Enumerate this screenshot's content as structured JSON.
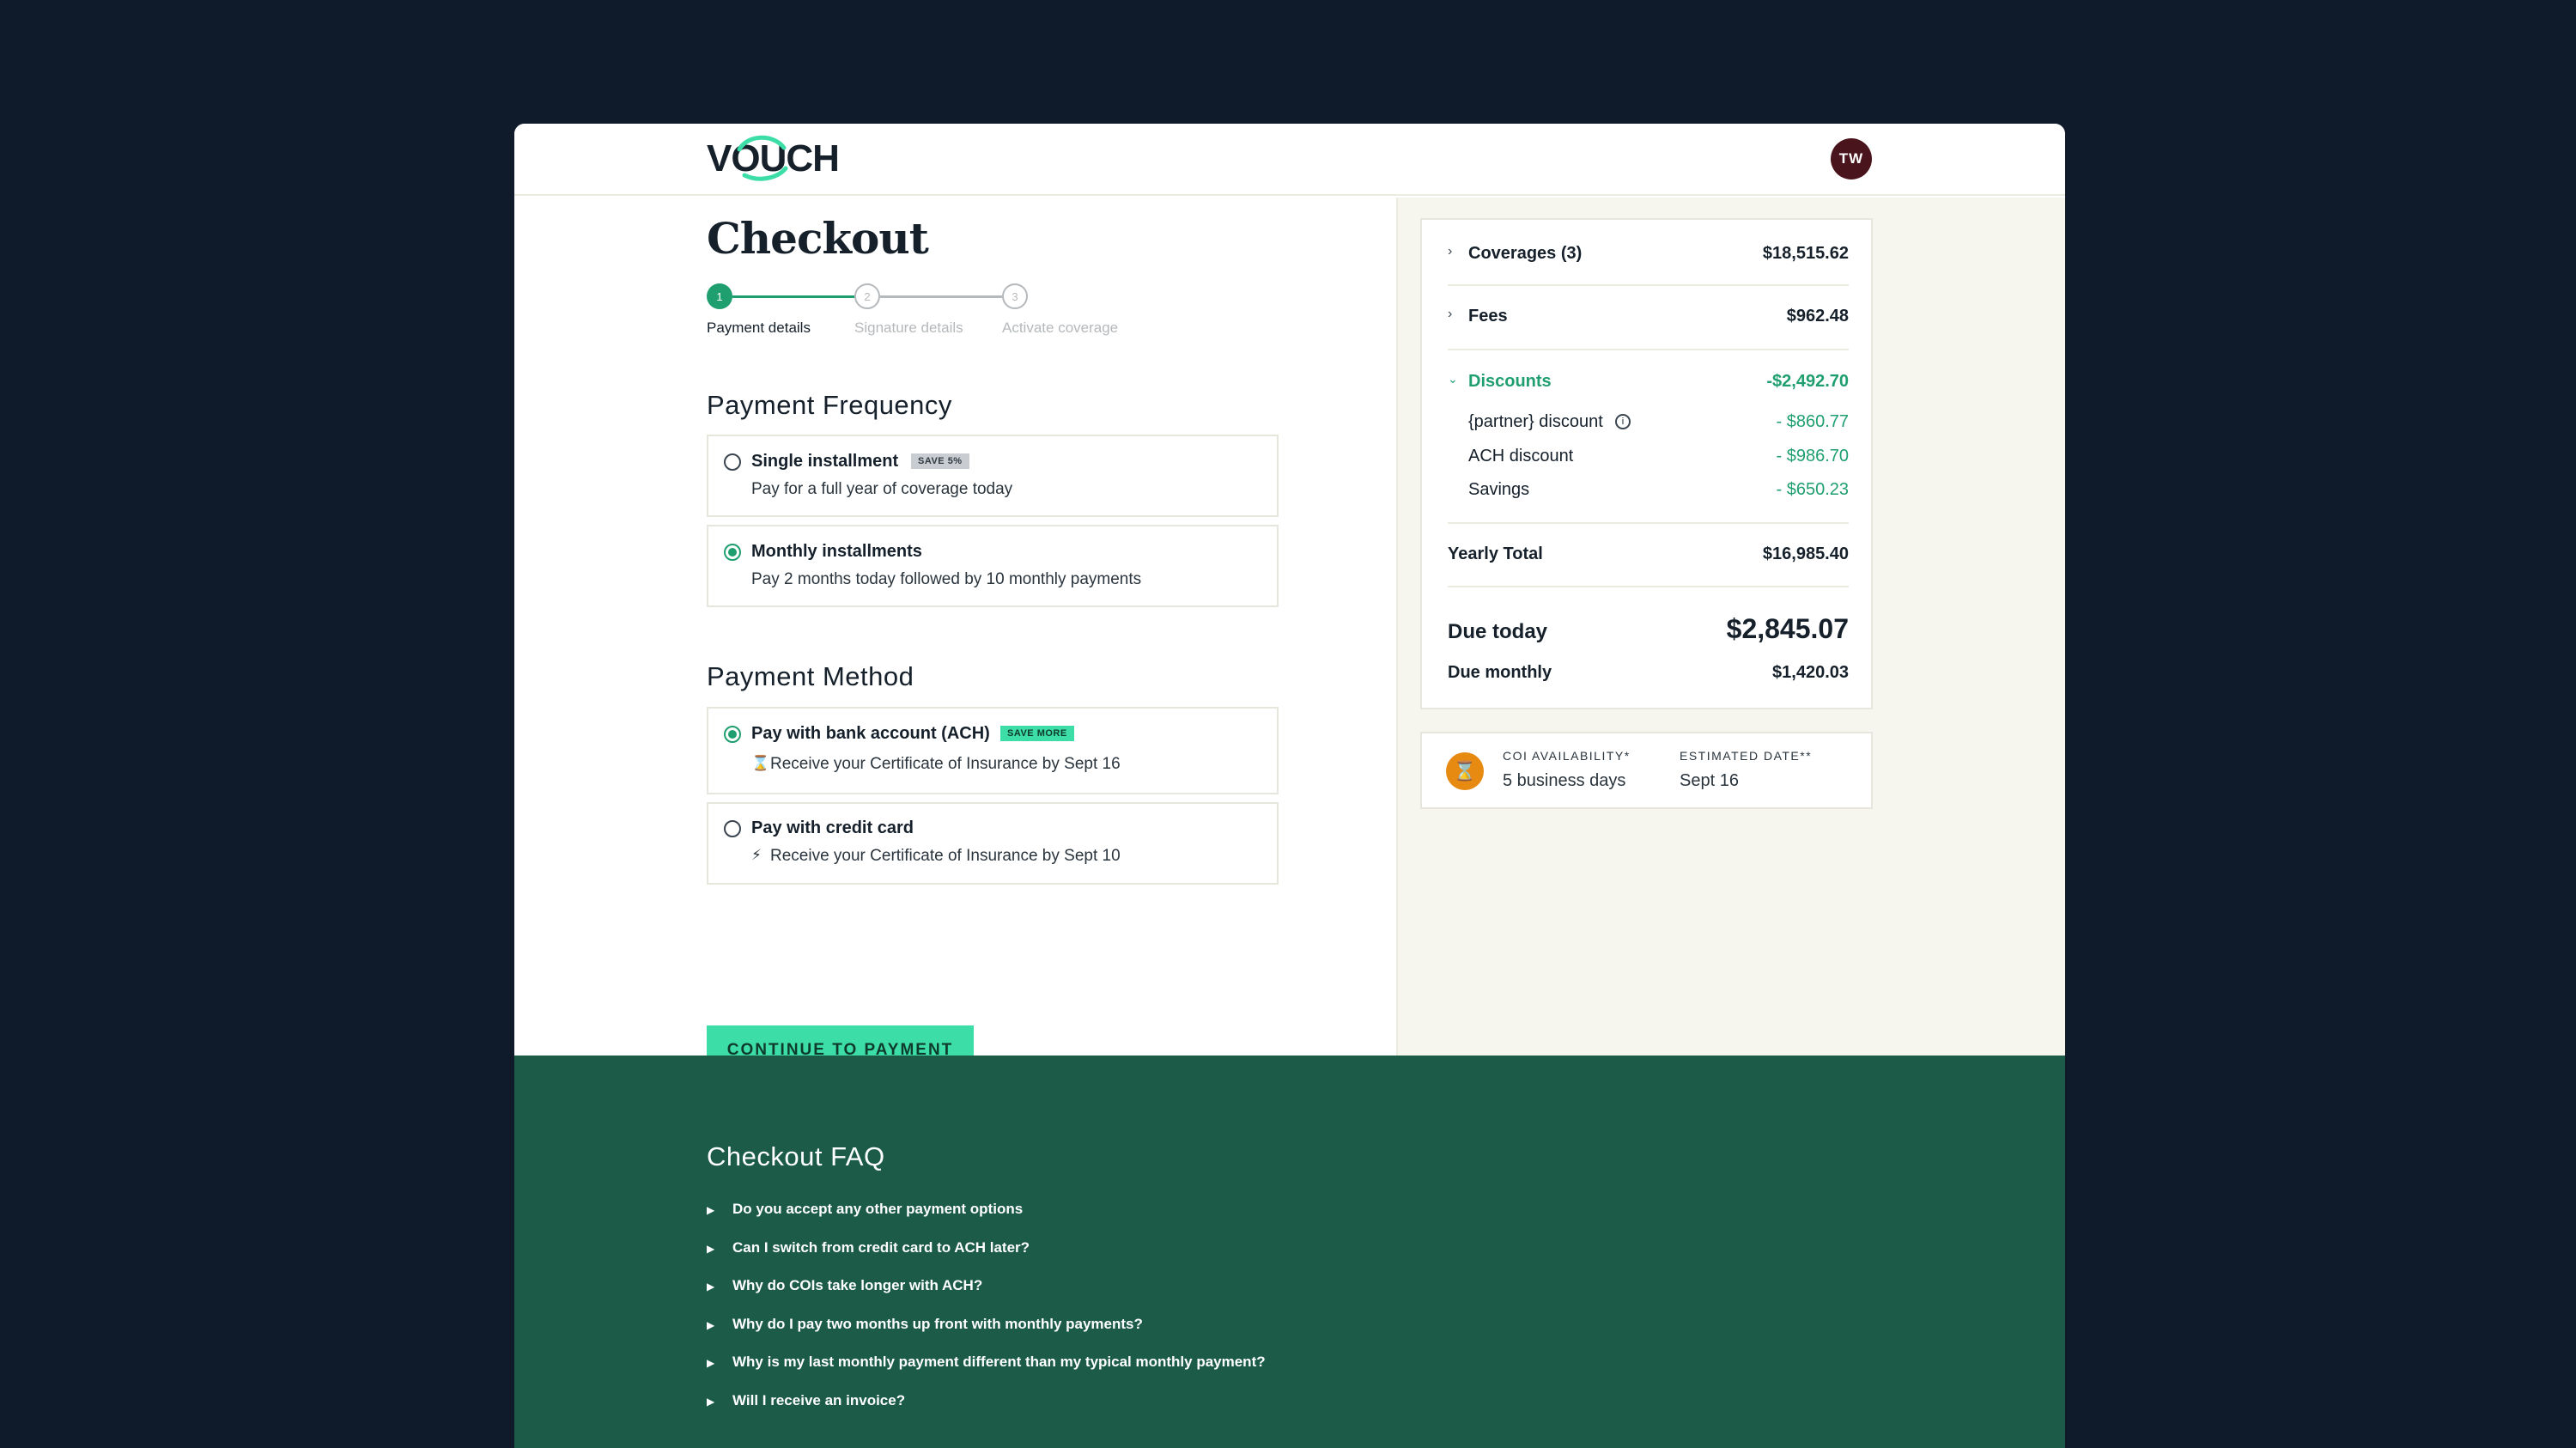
{
  "header": {
    "logo": "VOUCH",
    "avatar_initials": "TW"
  },
  "page": {
    "title": "Checkout"
  },
  "stepper": {
    "steps": [
      {
        "number": "1",
        "label": "Payment details"
      },
      {
        "number": "2",
        "label": "Signature details"
      },
      {
        "number": "3",
        "label": "Activate coverage"
      }
    ]
  },
  "frequency": {
    "title": "Payment Frequency",
    "options": [
      {
        "title": "Single installment",
        "badge": "SAVE 5%",
        "subtitle": "Pay for a full year of coverage today"
      },
      {
        "title": "Monthly installments",
        "subtitle": "Pay 2 months today followed by 10 monthly payments"
      }
    ]
  },
  "method": {
    "title": "Payment Method",
    "options": [
      {
        "title": "Pay with bank account (ACH)",
        "badge": "SAVE MORE",
        "icon": "⌛",
        "subtitle": "Receive your Certificate of Insurance by Sept 16"
      },
      {
        "title": "Pay with credit card",
        "icon": "⚡",
        "subtitle": "Receive your Certificate of Insurance by Sept 10"
      }
    ]
  },
  "cta": {
    "label": "CONTINUE TO PAYMENT"
  },
  "summary": {
    "coverages": {
      "label": "Coverages (3)",
      "value": "$18,515.62"
    },
    "fees": {
      "label": "Fees",
      "value": "$962.48"
    },
    "discounts": {
      "label": "Discounts",
      "value": "-$2,492.70"
    },
    "discount_items": [
      {
        "label": "{partner} discount",
        "value": "- $860.77"
      },
      {
        "label": "ACH discount",
        "value": "- $986.70"
      },
      {
        "label": "Savings",
        "value": "- $650.23"
      }
    ],
    "yearly_total": {
      "label": "Yearly Total",
      "value": "$16,985.40"
    },
    "due_today": {
      "label": "Due today",
      "value": "$2,845.07"
    },
    "due_monthly": {
      "label": "Due monthly",
      "value": "$1,420.03"
    }
  },
  "coi": {
    "availability_label": "COI AVAILABILITY*",
    "availability_value": "5 business days",
    "date_label": "ESTIMATED DATE**",
    "date_value": "Sept 16"
  },
  "faq": {
    "title": "Checkout FAQ",
    "items": [
      "Do you accept any other payment options",
      "Can I switch from credit card to ACH later?",
      "Why do COIs take longer with ACH?",
      "Why do I pay two months up front with monthly payments?",
      "Why is my last monthly payment different than my typical monthly payment?",
      "Will I receive an invoice?"
    ]
  },
  "colors": {
    "background": "#0f1a2a",
    "accent_green": "#1f9f70",
    "cta_green": "#3ddda8",
    "faq_background": "#1b5b48",
    "avatar": "#4a141c",
    "coi_icon": "#e68a12"
  }
}
